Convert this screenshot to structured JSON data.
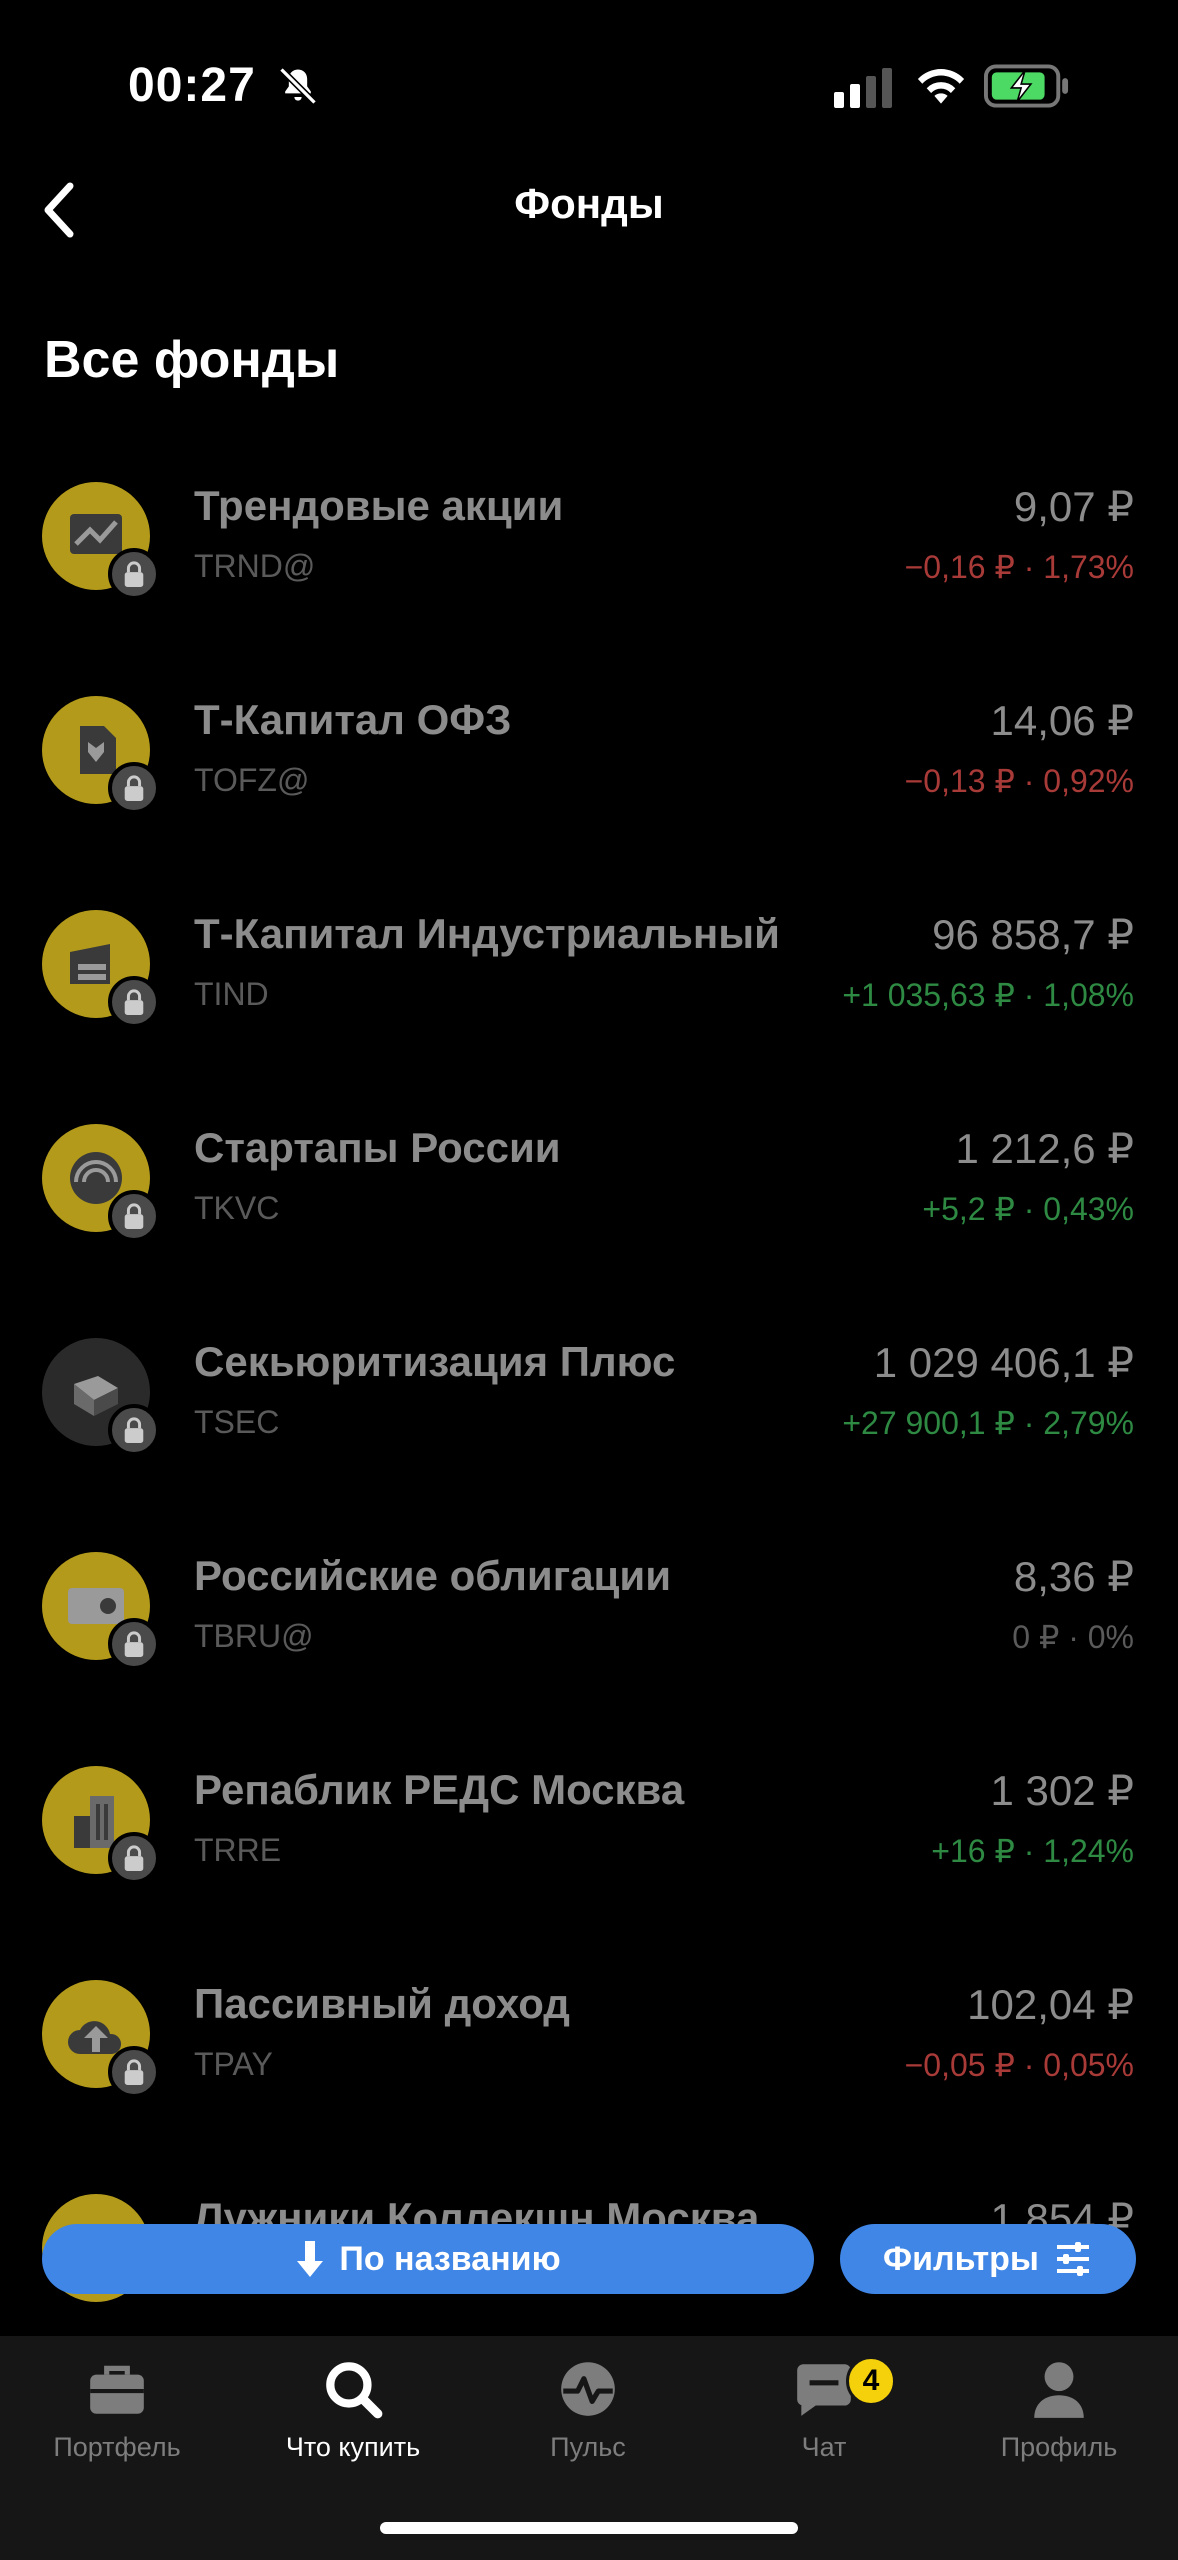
{
  "status_bar": {
    "time": "00:27",
    "icons": [
      "bell-off-icon",
      "cellular-signal-icon",
      "wifi-icon",
      "battery-charging-icon"
    ]
  },
  "header": {
    "title": "Фонды",
    "back_icon": "chevron-left-icon"
  },
  "section": {
    "title": "Все фонды"
  },
  "funds": [
    {
      "name": "Трендовые акции",
      "ticker": "TRND@",
      "price": "9,07 ₽",
      "change": "−0,16 ₽ · 1,73%",
      "direction": "negative",
      "icon": "trend-chart-icon"
    },
    {
      "name": "Т-Капитал ОФЗ",
      "ticker": "TOFZ@",
      "price": "14,06 ₽",
      "change": "−0,13 ₽ · 0,92%",
      "direction": "negative",
      "icon": "state-bond-eagle-icon"
    },
    {
      "name": "Т-Капитал Индустриальный",
      "ticker": "TIND",
      "price": "96 858,7 ₽",
      "change": "+1 035,63 ₽ · 1,08%",
      "direction": "positive",
      "icon": "industrial-building-icon"
    },
    {
      "name": "Стартапы России",
      "ticker": "TKVC",
      "price": "1 212,6 ₽",
      "change": "+5,2 ₽ · 0,43%",
      "direction": "positive",
      "icon": "startup-rings-icon"
    },
    {
      "name": "Секьюритизация Плюс",
      "ticker": "TSEC",
      "price": "1 029 406,1 ₽",
      "change": "+27 900,1 ₽ · 2,79%",
      "direction": "positive",
      "icon": "securitization-box-icon"
    },
    {
      "name": "Российские облигации",
      "ticker": "TBRU@",
      "price": "8,36 ₽",
      "change": "0 ₽ · 0%",
      "direction": "neutral",
      "icon": "bond-certificate-icon"
    },
    {
      "name": "Репаблик РЕДС Москва",
      "ticker": "TRRE",
      "price": "1 302 ₽",
      "change": "+16 ₽ · 1,24%",
      "direction": "positive",
      "icon": "city-buildings-icon"
    },
    {
      "name": "Пассивный доход",
      "ticker": "TPAY",
      "price": "102,04 ₽",
      "change": "−0,05 ₽ · 0,05%",
      "direction": "negative",
      "icon": "cloud-upload-icon"
    },
    {
      "name": "Лужники Коллекшн Москва",
      "ticker": "",
      "price": "1 854 ₽",
      "change": "",
      "direction": "neutral",
      "icon": "building-icon"
    }
  ],
  "lock_icon": "lock-icon",
  "actions": {
    "sort_label": "По названию",
    "sort_icon": "arrow-down-icon",
    "filter_label": "Фильтры",
    "filter_icon": "sliders-icon"
  },
  "tab_bar": {
    "tabs": [
      {
        "label": "Портфель",
        "icon": "briefcase-icon",
        "active": false
      },
      {
        "label": "Что купить",
        "icon": "search-icon",
        "active": true
      },
      {
        "label": "Пульс",
        "icon": "pulse-icon",
        "active": false
      },
      {
        "label": "Чат",
        "icon": "chat-icon",
        "active": false,
        "badge": "4"
      },
      {
        "label": "Профиль",
        "icon": "profile-icon",
        "active": false
      }
    ]
  },
  "colors": {
    "accent": "#3f86e6",
    "negative": "#a83a38",
    "positive": "#2e8a43",
    "logo_gold": "#b39a1a",
    "badge": "#f5d10b"
  }
}
